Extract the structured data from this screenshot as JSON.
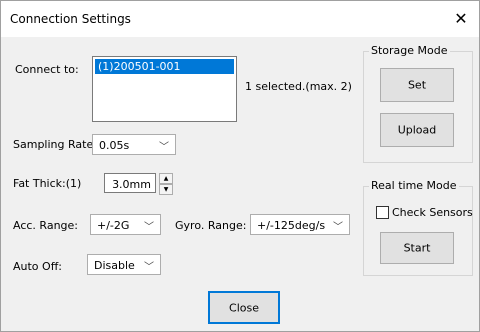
{
  "window": {
    "title": "Connection Settings"
  },
  "connect": {
    "label": "Connect to:",
    "items": [
      "(1)200501-001"
    ],
    "status": "1 selected.(max. 2)"
  },
  "sampling": {
    "label": "Sampling Rate:",
    "value": "0.05s"
  },
  "fat": {
    "label": "Fat Thick:(1)",
    "value": "3.0mm"
  },
  "acc": {
    "label": "Acc. Range:",
    "value": "+/-2G"
  },
  "gyro": {
    "label": "Gyro. Range:",
    "value": "+/-125deg/s"
  },
  "auto_off": {
    "label": "Auto  Off:",
    "value": "Disable"
  },
  "storage": {
    "title": "Storage Mode",
    "set_label": "Set",
    "upload_label": "Upload"
  },
  "realtime": {
    "title": "Real time Mode",
    "check_label": "Check Sensors",
    "check_checked": false,
    "start_label": "Start"
  },
  "footer": {
    "close_label": "Close"
  }
}
